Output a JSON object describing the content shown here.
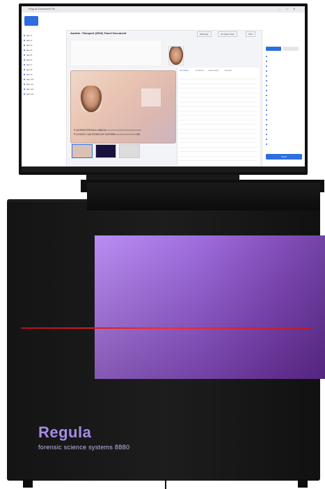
{
  "window": {
    "title": "Regula Document Re..."
  },
  "toolbar": {
    "btn1": "",
    "btn2": "",
    "right_btn": ""
  },
  "document": {
    "title": "Austria - Passport (2006) Travel Document",
    "toolbar_actions": [
      "Warnings",
      "Compare View",
      "Print"
    ]
  },
  "sidebar": {
    "items": [
      "Item 1",
      "Item 2",
      "Item 3",
      "Item 4",
      "Item 5",
      "Item 6",
      "Item 7",
      "Item 8",
      "Item 9",
      "Item 10",
      "Item 11",
      "Item 12",
      "Item 13"
    ]
  },
  "mrz": {
    "line1": "P<AUTMUSTERFRAU<<MARIA<<<<<<<<<<<<<<<<<<<<<<<<",
    "line2": "P1234567<1AUT8508125F1507098<<<<<<<<<<<<<<<00"
  },
  "panel": {
    "tabs": [
      "Text Data",
      "Graphics",
      "Authenticity",
      "Results"
    ],
    "rows": [
      "",
      "",
      "",
      "",
      "",
      "",
      "",
      "",
      "",
      "",
      "",
      "",
      "",
      "",
      "",
      "",
      "",
      "",
      ""
    ]
  },
  "rightcol": {
    "items": [
      "",
      "",
      "",
      "",
      "",
      "",
      "",
      "",
      "",
      "",
      "",
      "",
      "",
      "",
      "",
      "",
      "",
      "",
      ""
    ],
    "button": "Read"
  },
  "device": {
    "brand": "Regula",
    "subtitle": "forensic science systems 8880"
  },
  "colors": {
    "accent": "#2d6ee0",
    "brand_purple": "#a58be8",
    "red_strip": "#ff2a2a"
  }
}
